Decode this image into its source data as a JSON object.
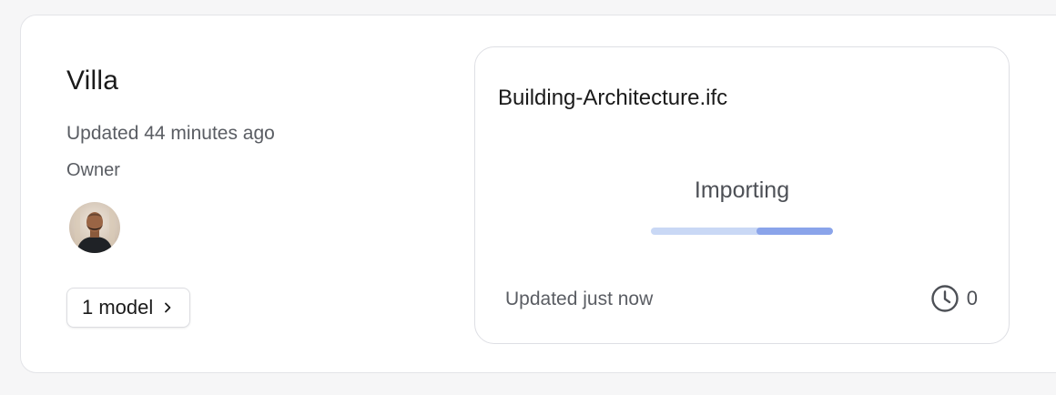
{
  "project": {
    "title": "Villa",
    "updated": "Updated 44 minutes ago",
    "role": "Owner",
    "models_button_label": "1 model"
  },
  "model": {
    "filename": "Building-Architecture.ifc",
    "status": "Importing",
    "progress_fraction": 0.58,
    "updated": "Updated just now",
    "history_count": "0"
  },
  "icons": {
    "models_chevron": "chevron-right-icon",
    "history": "clock-icon"
  },
  "colors": {
    "progress_track": "#c9d8f5",
    "progress_fill": "#8aa4ea"
  }
}
